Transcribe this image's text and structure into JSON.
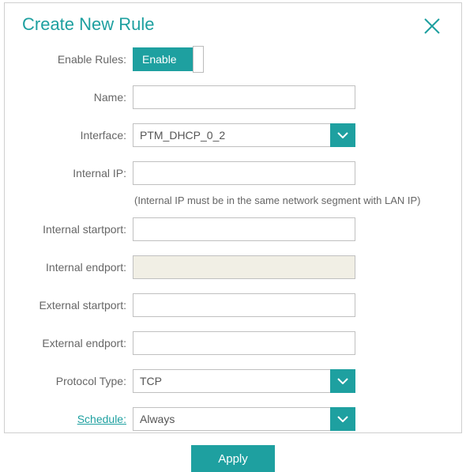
{
  "header": {
    "title": "Create New Rule"
  },
  "form": {
    "enable_rules": {
      "label": "Enable Rules:",
      "toggle_text": "Enable"
    },
    "name": {
      "label": "Name:",
      "value": ""
    },
    "interface": {
      "label": "Interface:",
      "value": "PTM_DHCP_0_2"
    },
    "internal_ip": {
      "label": "Internal IP:",
      "value": "",
      "helper": "(Internal IP must be in the same network segment with LAN IP)"
    },
    "internal_startport": {
      "label": "Internal startport:",
      "value": ""
    },
    "internal_endport": {
      "label": "Internal endport:",
      "value": ""
    },
    "external_startport": {
      "label": "External startport:",
      "value": ""
    },
    "external_endport": {
      "label": "External endport:",
      "value": ""
    },
    "protocol_type": {
      "label": "Protocol Type:",
      "value": "TCP"
    },
    "schedule": {
      "label": "Schedule:",
      "value": "Always"
    },
    "apply": {
      "label": "Apply"
    }
  }
}
